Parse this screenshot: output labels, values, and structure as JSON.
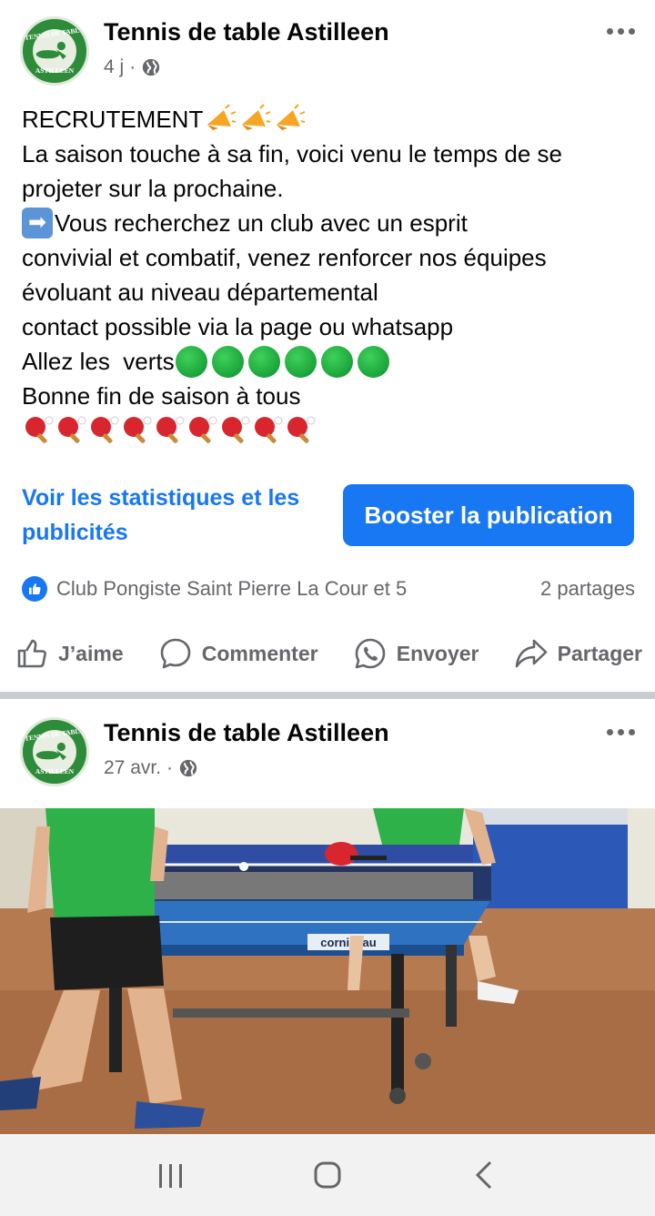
{
  "post1": {
    "page_name": "Tennis de table Astilleen",
    "time": "4 j",
    "dot": "·",
    "lines": [
      "RECRUTEMENT",
      "La saison touche à sa fin, voici venu le temps de se",
      "projeter sur la prochaine.",
      "Vous recherchez un club avec un esprit",
      "convivial et combatif, venez renforcer nos équipes",
      "évoluant au niveau départemental",
      "contact possible via la page ou whatsapp",
      "Allez les  verts",
      "Bonne fin de saison à tous"
    ],
    "stats_link": "Voir les statistiques et les publicités",
    "boost_label": "Booster la publication",
    "reactions_text": "Club Pongiste Saint Pierre La Cour et 5",
    "shares_text": "2 partages",
    "actions": {
      "like": "J’aime",
      "comment": "Commenter",
      "send": "Envoyer",
      "share": "Partager"
    }
  },
  "post2": {
    "page_name": "Tennis de table Astilleen",
    "time": "27 avr.",
    "dot": "·",
    "table_brand": "cornilleau"
  },
  "logo": {
    "text_top": "TENNIS DE TABLE",
    "text_bottom": "ASTILLEEN"
  },
  "colors": {
    "accent": "#1877f2",
    "secondary_text": "#65676b",
    "logo_green": "#2e8b3a"
  },
  "icons": [
    "globe-icon",
    "more-icon",
    "like-icon",
    "comment-icon",
    "whatsapp-icon",
    "share-icon",
    "megaphone-icon",
    "green-circle-icon",
    "ping-pong-icon",
    "right-arrow-icon"
  ]
}
